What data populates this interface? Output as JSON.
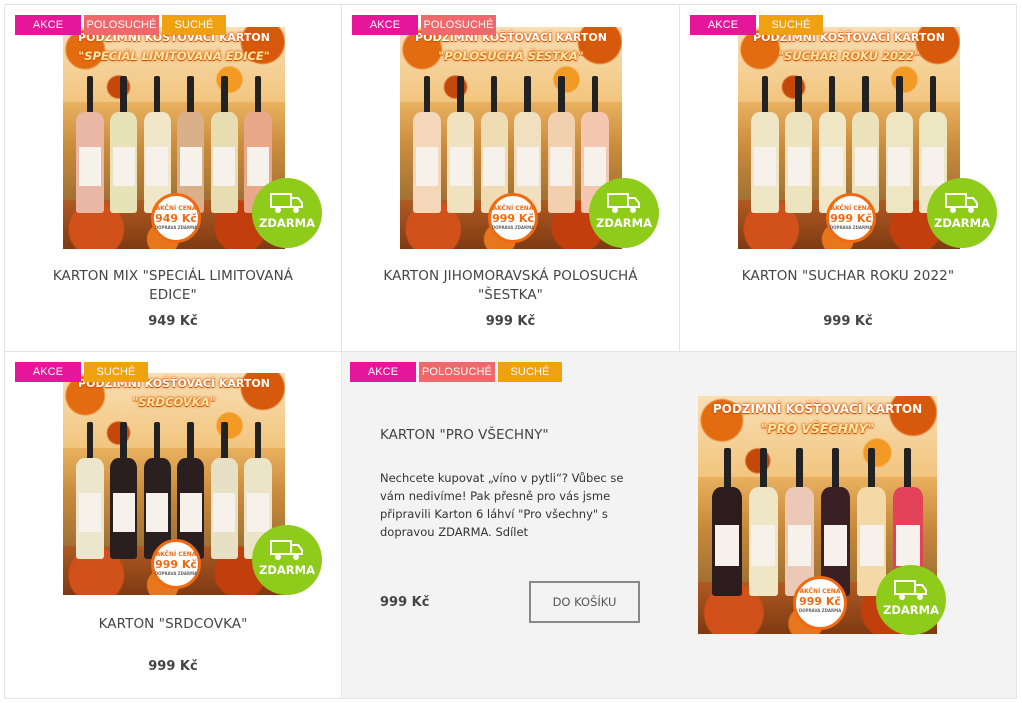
{
  "flag_labels": {
    "akce": "AKCE",
    "polosuche": "POLOSUCHÉ",
    "suche": "SUCHÉ"
  },
  "image_texts": {
    "banner_title": "PODZIMNÍ KOŠŤOVACÍ KARTON",
    "price_badge_label": "AKČNÍ CENA",
    "price_badge_note": "DOPRAVA ZDARMA",
    "free_badge": "ZDARMA"
  },
  "products": [
    {
      "flags": [
        "AKCE",
        "POLOSUCHÉ",
        "SUCHÉ"
      ],
      "image_subtitle": "\"SPECIÁL LIMITOVANÁ EDICE\"",
      "image_price": "949 Kč",
      "title": "KARTON MIX \"SPECIÁL LIMITOVANÁ EDICE\"",
      "price": "949 Kč"
    },
    {
      "flags": [
        "AKCE",
        "POLOSUCHÉ"
      ],
      "image_subtitle": "\"POLOSUCHÁ ŠESTKA\"",
      "image_price": "999 Kč",
      "title": "KARTON JIHOMORAVSKÁ POLOSUCHÁ \"ŠESTKA\"",
      "price": "999 Kč"
    },
    {
      "flags": [
        "AKCE",
        "SUCHÉ"
      ],
      "image_subtitle": "\"SUCHAR ROKU 2022\"",
      "image_price": "999 Kč",
      "title": "KARTON \"SUCHAR ROKU 2022\"",
      "price": "999 Kč"
    },
    {
      "flags": [
        "AKCE",
        "SUCHÉ"
      ],
      "image_subtitle": "\"SRDCOVKA\"",
      "image_price": "999 Kč",
      "title": "KARTON \"SRDCOVKA\"",
      "price": "999 Kč"
    }
  ],
  "featured": {
    "flags": [
      "AKCE",
      "POLOSUCHÉ",
      "SUCHÉ"
    ],
    "title": "KARTON \"PRO VŠECHNY\"",
    "description": "Nechcete kupovat „víno v pytli“? Vůbec se vám nedivíme! Pak přesně pro vás jsme připravili Karton 6 láhví \"Pro všechny\" s dopravou ZDARMA. Sdílet",
    "price": "999 Kč",
    "cart_button": "DO KOŠÍKU",
    "image_subtitle": "\"PRO VŠECHNY\"",
    "image_price": "999 Kč"
  },
  "colors": {
    "akce": "#e5169a",
    "polosuche": "#f0686b",
    "suche": "#f0a10f",
    "free_badge": "#8ecb1a",
    "price_badge": "#f06a12"
  }
}
